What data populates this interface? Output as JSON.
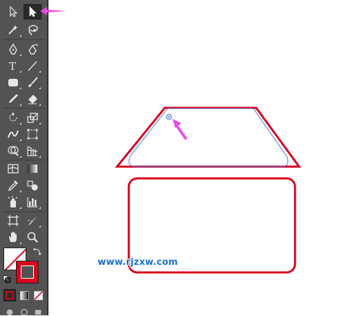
{
  "toolbar": {
    "tools": [
      {
        "name": "selection-tool",
        "icon": "selection-arrow-icon",
        "active": false
      },
      {
        "name": "direct-selection-tool",
        "icon": "direct-selection-arrow-icon",
        "active": true
      },
      {
        "name": "magic-wand-tool",
        "icon": "magic-wand-icon"
      },
      {
        "name": "lasso-tool",
        "icon": "lasso-icon"
      },
      {
        "name": "pen-tool",
        "icon": "pen-icon"
      },
      {
        "name": "curvature-tool",
        "icon": "curvature-pen-icon"
      },
      {
        "name": "type-tool",
        "icon": "type-icon",
        "label": "T"
      },
      {
        "name": "line-tool",
        "icon": "line-segment-icon"
      },
      {
        "name": "rectangle-tool",
        "icon": "rounded-rectangle-icon"
      },
      {
        "name": "paintbrush-tool",
        "icon": "paintbrush-icon"
      },
      {
        "name": "pencil-tool",
        "icon": "pencil-icon"
      },
      {
        "name": "eraser-tool",
        "icon": "eraser-icon"
      },
      {
        "name": "rotate-tool",
        "icon": "rotate-icon"
      },
      {
        "name": "scale-tool",
        "icon": "scale-icon"
      },
      {
        "name": "width-tool",
        "icon": "width-icon"
      },
      {
        "name": "free-transform-tool",
        "icon": "free-transform-icon"
      },
      {
        "name": "shape-builder-tool",
        "icon": "shape-builder-icon"
      },
      {
        "name": "perspective-grid-tool",
        "icon": "perspective-grid-icon"
      },
      {
        "name": "mesh-tool",
        "icon": "mesh-icon"
      },
      {
        "name": "gradient-tool",
        "icon": "gradient-icon"
      },
      {
        "name": "eyedropper-tool",
        "icon": "eyedropper-icon"
      },
      {
        "name": "blend-tool",
        "icon": "blend-icon"
      },
      {
        "name": "symbol-sprayer-tool",
        "icon": "symbol-sprayer-icon"
      },
      {
        "name": "column-graph-tool",
        "icon": "column-graph-icon"
      },
      {
        "name": "artboard-tool",
        "icon": "artboard-icon"
      },
      {
        "name": "slice-tool",
        "icon": "slice-icon"
      },
      {
        "name": "hand-tool",
        "icon": "hand-icon"
      },
      {
        "name": "zoom-tool",
        "icon": "zoom-icon"
      }
    ],
    "fill_stroke": {
      "fill": "none",
      "stroke_color": "#d9001b",
      "swap_icon": "swap-arrows-icon",
      "default_icon": "default-colors-icon"
    },
    "modes": [
      {
        "name": "color-mode",
        "icon": "color-icon",
        "color": "#d9001b"
      },
      {
        "name": "gradient-mode",
        "icon": "gradient-swatch-icon"
      },
      {
        "name": "none-mode",
        "icon": "none-icon"
      }
    ]
  },
  "annotations": {
    "arrow_color": "#e84fe2"
  },
  "canvas": {
    "shape_stroke_color": "#d9001b",
    "selection_color": "#4a78e0"
  },
  "watermark": {
    "text": "www.rjzxw.com"
  }
}
